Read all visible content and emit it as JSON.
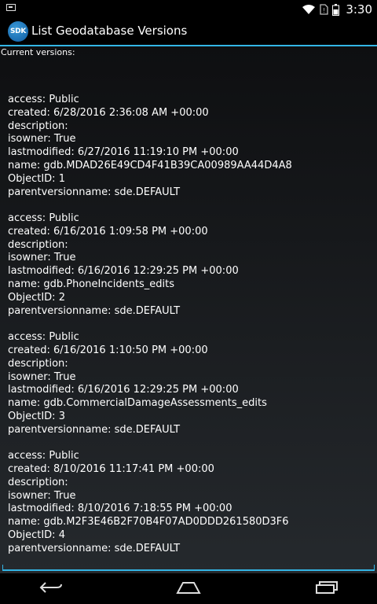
{
  "status_bar": {
    "time": "3:30",
    "icons": [
      "notification-icon",
      "wifi-icon",
      "no-sim-icon",
      "battery-icon"
    ]
  },
  "app": {
    "title": "List Geodatabase Versions",
    "icon_text": "SDK",
    "accent_color": "#33b5e5"
  },
  "content": {
    "header": "Current versions:",
    "versions": [
      {
        "lines": [
          "access: Public",
          "created: 6/28/2016 2:36:08 AM +00:00",
          "description:",
          "isowner: True",
          "lastmodified: 6/27/2016 11:19:10 PM +00:00",
          "name: gdb.MDAD26E49CD4F41B39CA00989AA44D4A8",
          "ObjectID: 1",
          "parentversionname: sde.DEFAULT"
        ]
      },
      {
        "lines": [
          "access: Public",
          "created: 6/16/2016 1:09:58 PM +00:00",
          "description:",
          "isowner: True",
          "lastmodified: 6/16/2016 12:29:25 PM +00:00",
          "name: gdb.PhoneIncidents_edits",
          "ObjectID: 2",
          "parentversionname: sde.DEFAULT"
        ]
      },
      {
        "lines": [
          "access: Public",
          "created: 6/16/2016 1:10:50 PM +00:00",
          "description:",
          "isowner: True",
          "lastmodified: 6/16/2016 12:29:25 PM +00:00",
          "name: gdb.CommercialDamageAssessments_edits",
          "ObjectID: 3",
          "parentversionname: sde.DEFAULT"
        ]
      },
      {
        "lines": [
          "access: Public",
          "created: 8/10/2016 11:17:41 PM +00:00",
          "description:",
          "isowner: True",
          "lastmodified: 8/10/2016 7:18:55 PM +00:00",
          "name: gdb.M2F3E46B2F70B4F07AD0DDD261580D3F6",
          "ObjectID: 4",
          "parentversionname: sde.DEFAULT"
        ]
      }
    ]
  },
  "nav_bar": {
    "buttons": [
      "back-icon",
      "home-icon",
      "recents-icon"
    ]
  }
}
